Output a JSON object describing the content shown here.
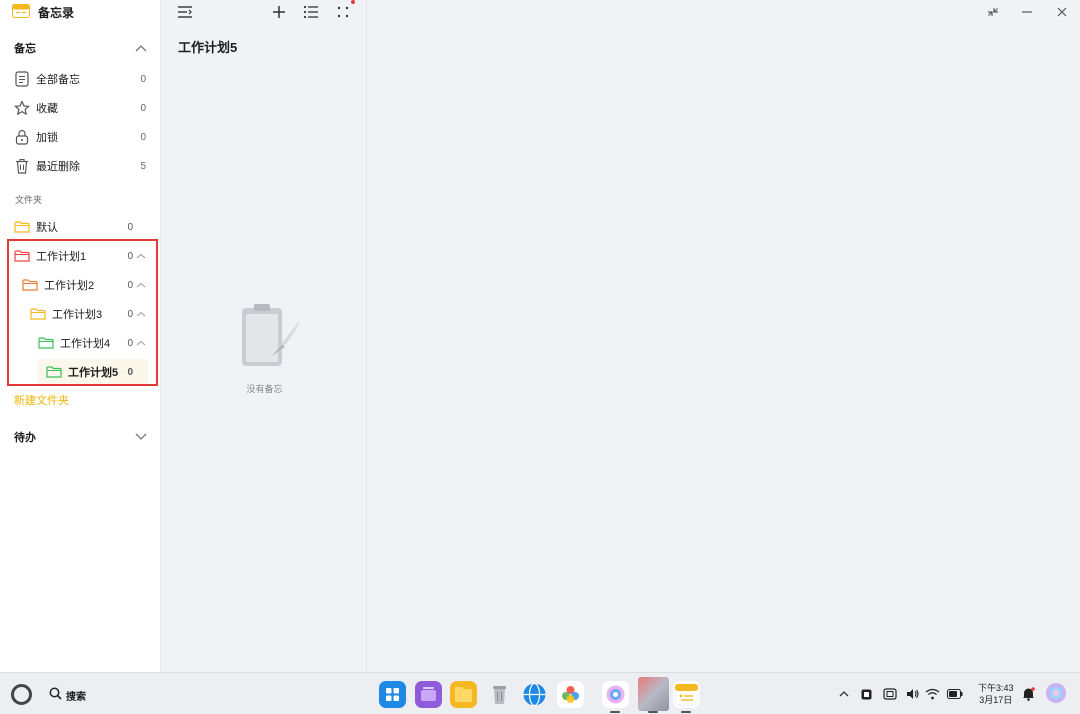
{
  "app": {
    "title": "备忘录"
  },
  "memo_section": {
    "title": "备忘",
    "items": [
      {
        "label": "全部备忘",
        "count": "0",
        "icon": "document-icon"
      },
      {
        "label": "收藏",
        "count": "0",
        "icon": "star-icon"
      },
      {
        "label": "加锁",
        "count": "0",
        "icon": "lock-icon"
      },
      {
        "label": "最近删除",
        "count": "5",
        "icon": "trash-icon"
      }
    ]
  },
  "folders": {
    "caption": "文件夹",
    "items": [
      {
        "label": "默认",
        "count": "0",
        "color": "#f5b820",
        "expandable": false
      },
      {
        "label": "工作计划1",
        "count": "0",
        "color": "#ef4444",
        "expandable": true
      },
      {
        "label": "工作计划2",
        "count": "0",
        "color": "#f07c32",
        "expandable": true
      },
      {
        "label": "工作计划3",
        "count": "0",
        "color": "#f5b820",
        "expandable": true
      },
      {
        "label": "工作计划4",
        "count": "0",
        "color": "#3cbf5a",
        "expandable": true
      },
      {
        "label": "工作计划5",
        "count": "0",
        "color": "#3cbf5a",
        "expandable": false,
        "selected": true
      }
    ],
    "new_folder_label": "新建文件夹"
  },
  "todo_section": {
    "title": "待办"
  },
  "list_pane": {
    "title": "工作计划5",
    "empty_text": "没有备忘"
  },
  "taskbar": {
    "search_label": "搜索",
    "clock_time": "下午3:43",
    "clock_date": "3月17日"
  },
  "colors": {
    "accent": "#f0b400",
    "highlight_border": "#e53935"
  }
}
